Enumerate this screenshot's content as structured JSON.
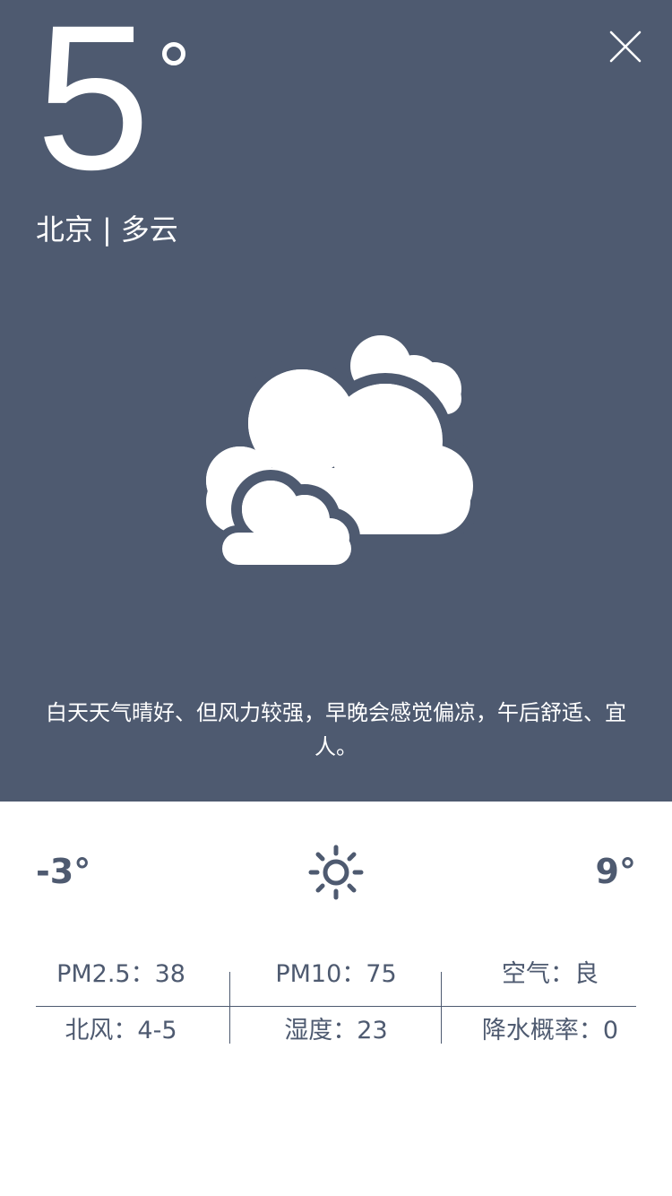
{
  "current": {
    "temperature": "5",
    "city": "北京",
    "separator": "|",
    "condition": "多云",
    "icon": "partly-cloudy-icon"
  },
  "summary": "白天天气晴好、但风力较强，早晚会感觉偏凉，午后舒适、宜人。",
  "range": {
    "low": "-3°",
    "high": "9°",
    "icon": "sun-icon"
  },
  "details": {
    "pm25": "PM2.5：38",
    "pm10": "PM10：75",
    "air": "空气：良",
    "wind": "北风：4-5",
    "humidity": "湿度：23",
    "precip": "降水概率：0"
  },
  "colors": {
    "header_bg": "#4e5a70",
    "text_dark": "#4e5a70",
    "white": "#ffffff"
  }
}
